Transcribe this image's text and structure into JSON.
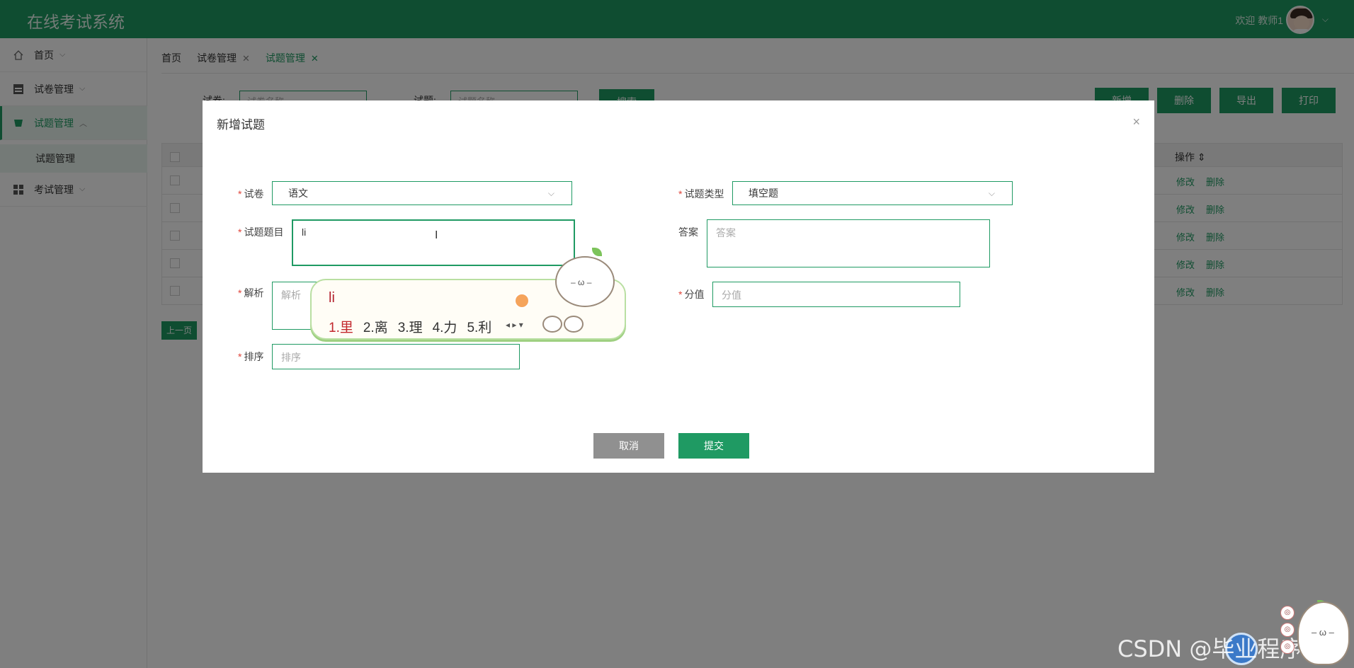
{
  "app": {
    "title": "在线考试系统",
    "welcome": "欢迎 教师1"
  },
  "sidebar": {
    "items": [
      {
        "label": "首页",
        "icon": "home-icon"
      },
      {
        "label": "试卷管理",
        "icon": "table-icon"
      },
      {
        "label": "试题管理",
        "icon": "question-icon"
      },
      {
        "label": "考试管理",
        "icon": "grid-icon"
      }
    ],
    "sub_active": "试题管理"
  },
  "tabs": [
    {
      "label": "首页"
    },
    {
      "label": "试卷管理",
      "close": "✕"
    },
    {
      "label": "试题管理",
      "close": "✕"
    }
  ],
  "toolbar": {
    "search_label_1": "试卷:",
    "search_label_2": "试题:",
    "search_placeholder_1": "试卷名称",
    "search_placeholder_2": "试题名称",
    "search_btn": "搜索",
    "add": "新增",
    "delete": "删除",
    "export": "导出",
    "print": "打印"
  },
  "table": {
    "op_header": "操作",
    "row_edit": "修改",
    "row_delete": "删除",
    "prev_page": "上一页"
  },
  "modal": {
    "title": "新增试题",
    "close": "×",
    "paper_label": "试卷",
    "paper_value": "语文",
    "type_label": "试题类型",
    "type_value": "填空题",
    "question_label": "试题题目",
    "question_value": "li",
    "answer_label": "答案",
    "answer_placeholder": "答案",
    "analysis_label": "解析",
    "analysis_placeholder": "解析",
    "score_label": "分值",
    "score_placeholder": "分值",
    "order_label": "排序",
    "order_placeholder": "排序",
    "cancel": "取消",
    "submit": "提交"
  },
  "ime": {
    "input": "li",
    "candidates": [
      "1.里",
      "2.离",
      "3.理",
      "4.力",
      "5.利"
    ]
  },
  "watermark": "CSDN @毕业程序员",
  "colors": {
    "primary": "#1f9a63",
    "overlay": "rgba(0,0,0,0.5)",
    "cancel": "#909090"
  }
}
